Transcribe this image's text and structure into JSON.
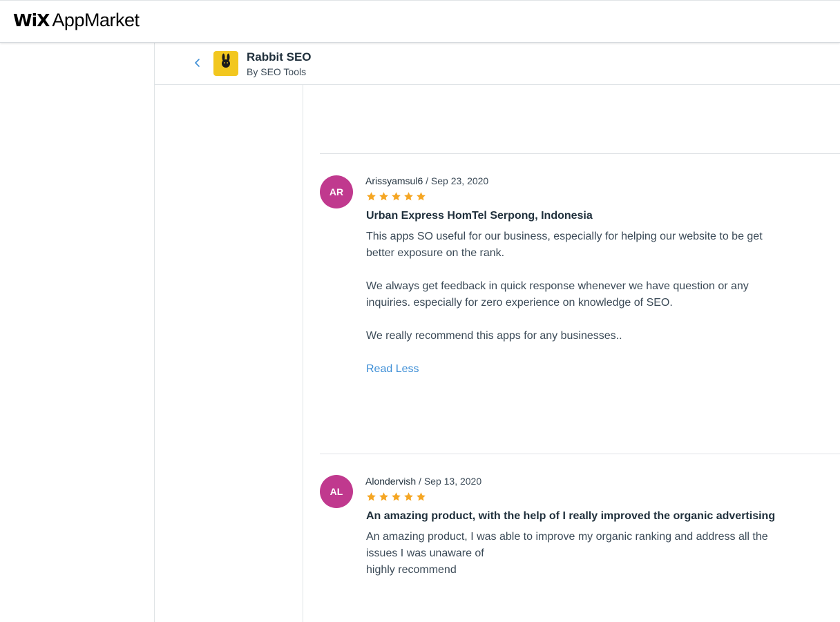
{
  "brand": {
    "wix": "WiX",
    "app_market": "AppMarket"
  },
  "app": {
    "name": "Rabbit SEO",
    "by_prefix": "By",
    "developer": "SEO Tools",
    "icon_text": "RabbitSEO",
    "icon_color": "#f2c71f"
  },
  "colors": {
    "avatar": "#c0398e",
    "star": "#f5a623",
    "link": "#3d8ed6"
  },
  "reviews": [
    {
      "initials": "AR",
      "author": "Arissyamsul6",
      "separator": " / ",
      "date": "Sep 23, 2020",
      "rating": 5,
      "title": "Urban Express HomTel Serpong, Indonesia",
      "body": "This apps SO useful for our business, especially for helping our website to be get better exposure on the rank.\n\nWe always get feedback in quick response whenever we have question or any inquiries. especially for zero experience on knowledge of SEO.\n\nWe really recommend this apps for any businesses..",
      "toggle_label": "Read Less"
    },
    {
      "initials": "AL",
      "author": "Alondervish",
      "separator": " / ",
      "date": "Sep 13, 2020",
      "rating": 5,
      "title": "An amazing product, with the help of I really improved the organic advertising",
      "body": "An amazing product, I was able to improve my organic ranking and address all the issues I was unaware of\nhighly recommend"
    }
  ]
}
